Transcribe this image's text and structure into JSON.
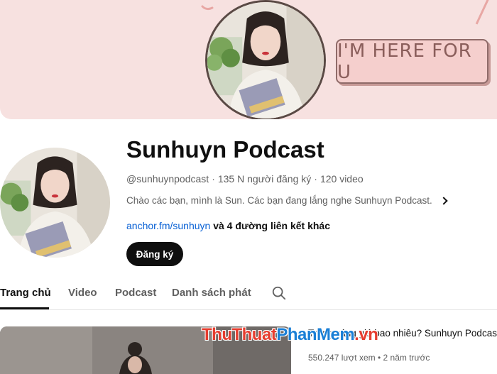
{
  "banner": {
    "badge_text": "I'M HERE FOR U",
    "background_color": "#f7e1e0"
  },
  "channel": {
    "name": "Sunhuyn Podcast",
    "handle": "@sunhuynpodcast",
    "subscribers": "135 N người đăng ký",
    "video_count": "120 video",
    "separator": "·",
    "description": "Chào các bạn, mình là Sun. Các bạn đang lắng nghe Sunhuyn Podcast.",
    "link_text": "anchor.fm/sunhuyn",
    "more_links": "và 4 đường liên kết khác",
    "subscribe_label": "Đăng ký"
  },
  "tabs": [
    {
      "label": "Trang chủ",
      "active": true
    },
    {
      "label": "Video",
      "active": false
    },
    {
      "label": "Podcast",
      "active": false
    },
    {
      "label": "Danh sách phát",
      "active": false
    }
  ],
  "tab_search_icon": "search-icon",
  "featured_video": {
    "title": "Trang sáng giá bao nhiêu? Sunhuyn Podcast",
    "views": "550.247 lượt xem",
    "age": "2 năm trước",
    "separator": "•"
  },
  "watermark": {
    "part1": "ThuThuat",
    "part2": "PhanMem",
    "part3": ".vn"
  },
  "colors": {
    "accent_link": "#065fd4",
    "subscribe_bg": "#0f0f0f",
    "text_secondary": "#606060"
  }
}
